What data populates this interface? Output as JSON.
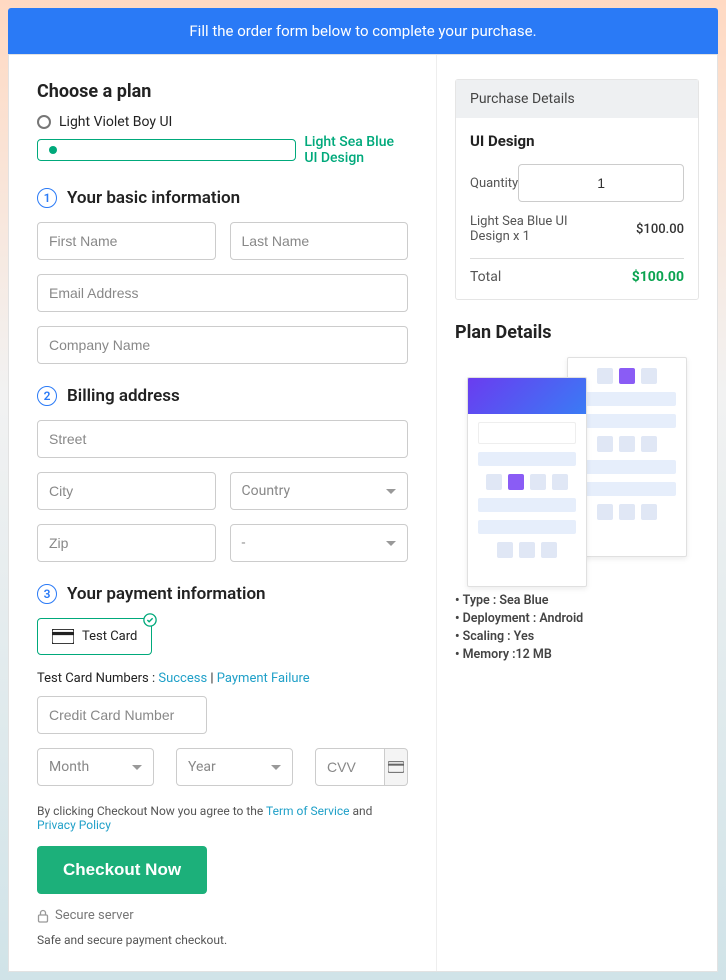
{
  "banner": "Fill the order form below to complete your purchase.",
  "form": {
    "choose_plan": "Choose a plan",
    "plans": [
      {
        "label": "Light Violet Boy UI",
        "selected": false
      },
      {
        "label": "Light Sea Blue UI Design",
        "selected": true
      }
    ],
    "sec1": {
      "num": "1",
      "title": "Your basic information"
    },
    "first_name": "First Name",
    "last_name": "Last Name",
    "email": "Email Address",
    "company": "Company Name",
    "sec2": {
      "num": "2",
      "title": "Billing address"
    },
    "street": "Street",
    "city": "City",
    "country": "Country",
    "zip": "Zip",
    "state": "-",
    "sec3": {
      "num": "3",
      "title": "Your payment information"
    },
    "card_label": "Test  Card",
    "test_prefix": "Test Card Numbers : ",
    "success_link": "Success",
    "sep": " | ",
    "failure_link": "Payment Failure",
    "cc_number": "Credit Card Number",
    "month": "Month",
    "year": "Year",
    "cvv": "CVV",
    "agree_pre": "By clicking Checkout Now you agree to the ",
    "tos": "Term of Service",
    "and": " and ",
    "pp": "Privacy Policy",
    "checkout": "Checkout Now",
    "secure": "Secure server",
    "safe": "Safe and secure payment checkout."
  },
  "purchase": {
    "head": "Purchase Details",
    "product": "UI Design",
    "qty_label": "Quantity",
    "qty": "1",
    "line_item": "Light Sea Blue UI Design x 1",
    "line_price": "$100.00",
    "total_label": "Total",
    "total": "$100.00"
  },
  "plan_details": {
    "title": "Plan Details",
    "bullets": [
      "Type : Sea Blue",
      "Deployment : Android",
      "Scaling : Yes",
      "Memory :12 MB"
    ]
  }
}
